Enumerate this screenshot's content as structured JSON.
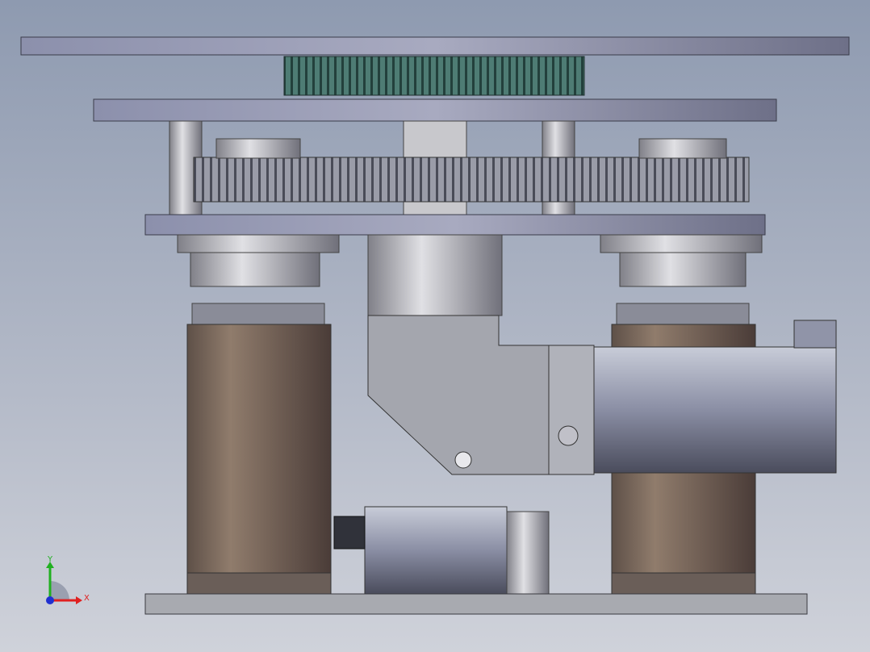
{
  "viewport": {
    "background_top": "#8e9ab0",
    "background_bottom": "#cfd2da"
  },
  "triad": {
    "x_label": "X",
    "y_label": "Y",
    "x_color": "#e02020",
    "y_color": "#20b020",
    "z_color": "#2030d0"
  },
  "colors": {
    "plate": "#9a9cb4",
    "gear_green": "#3e6a64",
    "gear_grey": "#a8aab4",
    "motor_brown": "#7a6858",
    "gearbox": "#a0a0a8"
  }
}
